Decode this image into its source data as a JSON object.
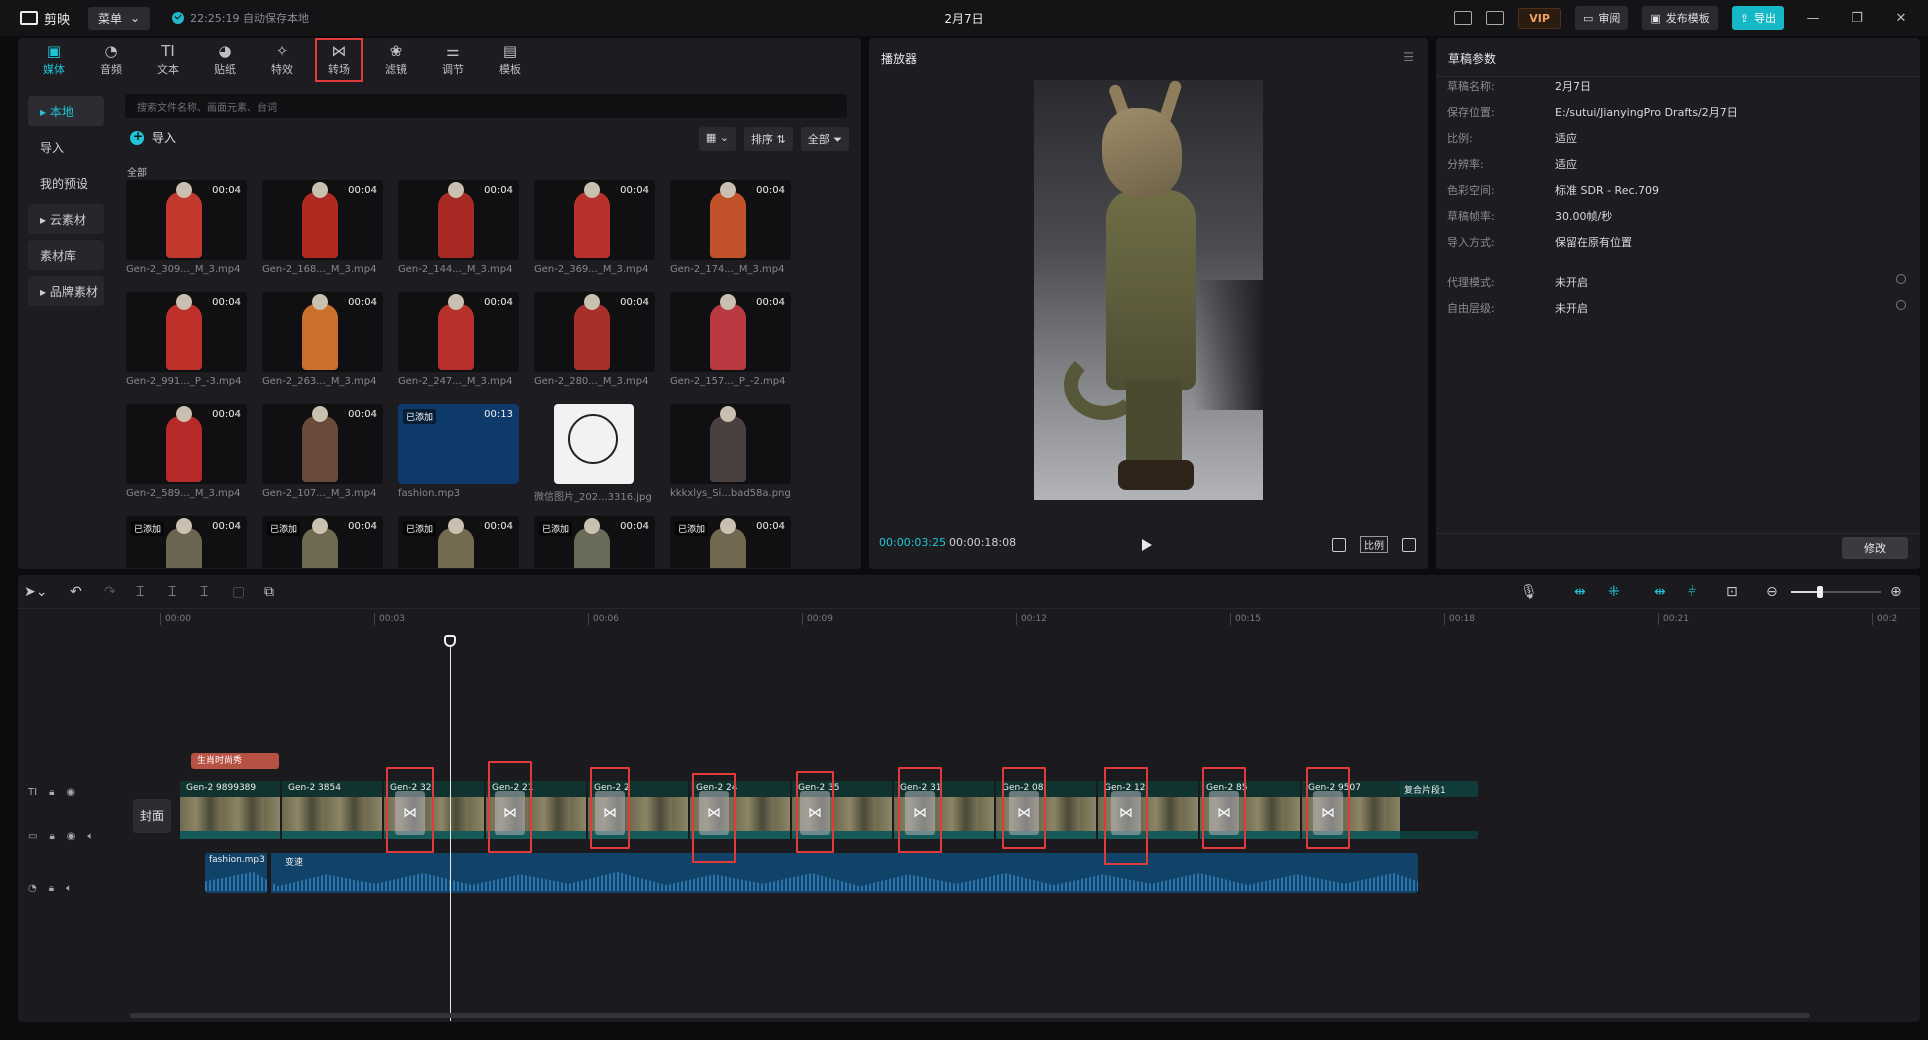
{
  "app": {
    "name": "剪映",
    "menu_label": "菜单",
    "autosave": "22:25:19 自动保存本地",
    "doc_title": "2月7日"
  },
  "topbar": {
    "vip": "VIP",
    "review": "审阅",
    "publish_template": "发布模板",
    "export": "导出"
  },
  "tools": [
    {
      "label": "媒体",
      "icon": "media-icon",
      "glyph": "▣"
    },
    {
      "label": "音频",
      "icon": "audio-icon",
      "glyph": "◔"
    },
    {
      "label": "文本",
      "icon": "text-icon",
      "glyph": "TI"
    },
    {
      "label": "贴纸",
      "icon": "sticker-icon",
      "glyph": "◕"
    },
    {
      "label": "特效",
      "icon": "effects-icon",
      "glyph": "✧"
    },
    {
      "label": "转场",
      "icon": "transition-icon",
      "glyph": "⋈"
    },
    {
      "label": "滤镜",
      "icon": "filter-icon",
      "glyph": "❀"
    },
    {
      "label": "调节",
      "icon": "adjust-icon",
      "glyph": "⚌"
    },
    {
      "label": "模板",
      "icon": "template-icon",
      "glyph": "▤"
    }
  ],
  "sidebar": [
    {
      "label": "▸ 本地"
    },
    {
      "label": "导入"
    },
    {
      "label": "我的预设"
    },
    {
      "label": "▸ 云素材"
    },
    {
      "label": "素材库"
    },
    {
      "label": "▸ 品牌素材"
    }
  ],
  "media": {
    "search_placeholder": "搜索文件名称、画面元素、台词",
    "import_label": "导入",
    "sort_label": "排序",
    "all_label": "全部",
    "group_label": "全部",
    "items": [
      {
        "name": "Gen-2_309..._M_3.mp4",
        "duration": "00:04",
        "added": "",
        "color": "#c2382c"
      },
      {
        "name": "Gen-2_168..._M_3.mp4",
        "duration": "00:04",
        "added": "",
        "color": "#b02a22"
      },
      {
        "name": "Gen-2_144..._M_3.mp4",
        "duration": "00:04",
        "added": "",
        "color": "#a82a24"
      },
      {
        "name": "Gen-2_369..._M_3.mp4",
        "duration": "00:04",
        "added": "",
        "color": "#b8312a"
      },
      {
        "name": "Gen-2_174..._M_3.mp4",
        "duration": "00:04",
        "added": "",
        "color": "#c2522a"
      },
      {
        "name": "Gen-2_991..._P_-3.mp4",
        "duration": "00:04",
        "added": "",
        "color": "#c0302a"
      },
      {
        "name": "Gen-2_263..._M_3.mp4",
        "duration": "00:04",
        "added": "",
        "color": "#c8702c"
      },
      {
        "name": "Gen-2_247..._M_3.mp4",
        "duration": "00:04",
        "added": "",
        "color": "#b8302a"
      },
      {
        "name": "Gen-2_280..._M_3.mp4",
        "duration": "00:04",
        "added": "",
        "color": "#a8302a"
      },
      {
        "name": "Gen-2_157..._P_-2.mp4",
        "duration": "00:04",
        "added": "",
        "color": "#b83a40"
      },
      {
        "name": "Gen-2_589..._M_3.mp4",
        "duration": "00:04",
        "added": "",
        "color": "#b82a2a"
      },
      {
        "name": "Gen-2_107..._M_3.mp4",
        "duration": "00:04",
        "added": "",
        "color": "#6a4a3a"
      },
      {
        "name": "fashion.mp3",
        "duration": "00:13",
        "added": "已添加",
        "color": "#0d3a6a"
      },
      {
        "name": "微信图片_202...3316.jpg",
        "duration": "",
        "added": "",
        "color": "#f2f2f2"
      },
      {
        "name": "kkkxlys_Si...bad58a.png",
        "duration": "",
        "added": "",
        "color": "#4a4040"
      },
      {
        "name": "",
        "duration": "00:04",
        "added": "已添加",
        "color": "#6a6450"
      },
      {
        "name": "",
        "duration": "00:04",
        "added": "已添加",
        "color": "#6e6a52"
      },
      {
        "name": "",
        "duration": "00:04",
        "added": "已添加",
        "color": "#746a50"
      },
      {
        "name": "",
        "duration": "00:04",
        "added": "已添加",
        "color": "#6a6a58"
      },
      {
        "name": "",
        "duration": "00:04",
        "added": "已添加",
        "color": "#706850"
      }
    ]
  },
  "player": {
    "title": "播放器",
    "current_time": "00:00:03:25",
    "total_time": "00:00:18:08",
    "ratio_label": "比例"
  },
  "props": {
    "title": "草稿参数",
    "rows": [
      {
        "k": "草稿名称:",
        "v": "2月7日"
      },
      {
        "k": "保存位置:",
        "v": "E:/sutui/JianyingPro Drafts/2月7日"
      },
      {
        "k": "比例:",
        "v": "适应"
      },
      {
        "k": "分辨率:",
        "v": "适应"
      },
      {
        "k": "色彩空间:",
        "v": "标准 SDR - Rec.709"
      },
      {
        "k": "草稿帧率:",
        "v": "30.00帧/秒"
      },
      {
        "k": "导入方式:",
        "v": "保留在原有位置"
      },
      {
        "k": "代理模式:",
        "v": "未开启"
      },
      {
        "k": "自由层级:",
        "v": "未开启"
      }
    ],
    "edit_label": "修改"
  },
  "timeline": {
    "ticks": [
      "00:00",
      "00:03",
      "00:06",
      "00:09",
      "00:12",
      "00:15",
      "00:18",
      "00:21",
      "00:2"
    ],
    "cover_label": "封面",
    "text_clip": "生肖时尚秀",
    "clips": [
      "Gen-2 9899389",
      "Gen-2 3854",
      "Gen-2 32",
      "Gen-2 21",
      "Gen-2 2",
      "Gen-2 24",
      "Gen-2 35",
      "Gen-2 31",
      "Gen-2 08",
      "Gen-2 12",
      "Gen-2 85",
      "Gen-2 9507"
    ],
    "compound_clip": "复合片段1",
    "audio_name": "fashion.mp3",
    "audio_name2": "变速"
  }
}
